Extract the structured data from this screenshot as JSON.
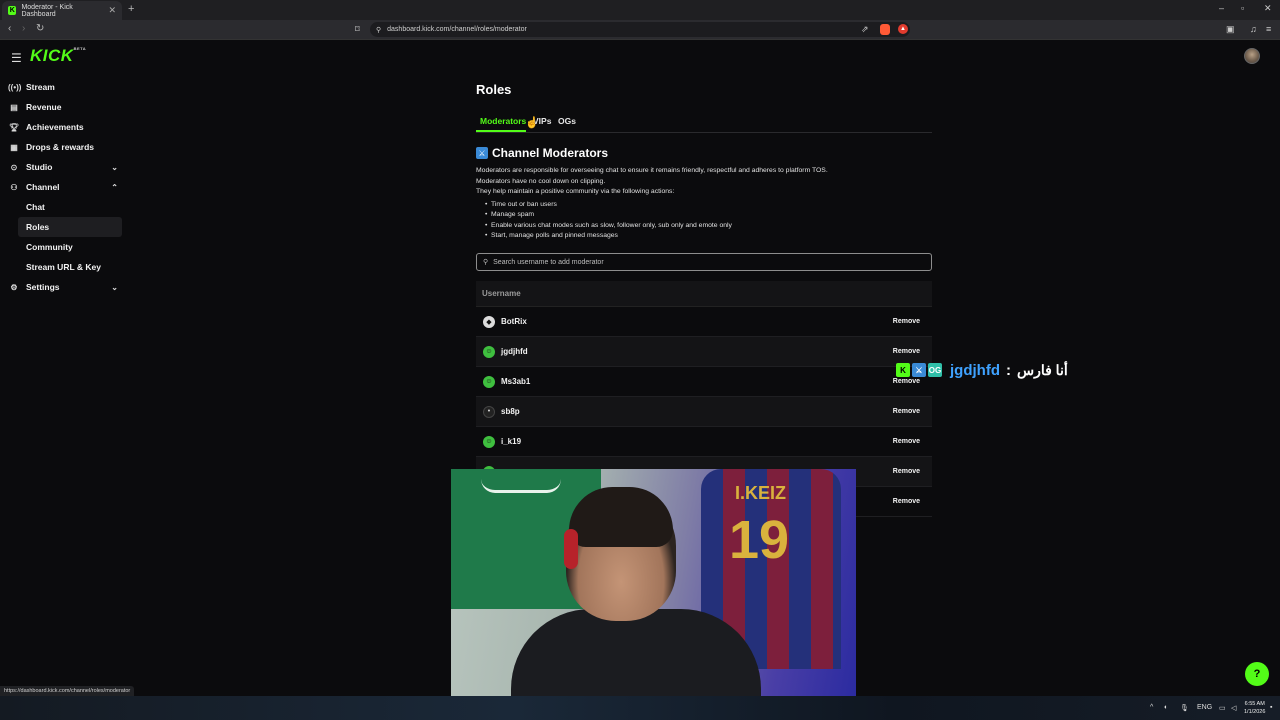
{
  "browser": {
    "tab_title": "Moderator - Kick Dashboard",
    "url": "dashboard.kick.com/channel/roles/moderator",
    "new_tab": "+",
    "status_url": "https://dashboard.kick.com/channel/roles/moderator"
  },
  "header": {
    "logo": "KICK",
    "logo_tag": "BETA"
  },
  "sidebar": {
    "items": [
      {
        "label": "Stream",
        "icon": "broadcast-icon"
      },
      {
        "label": "Revenue",
        "icon": "revenue-icon"
      },
      {
        "label": "Achievements",
        "icon": "trophy-icon"
      },
      {
        "label": "Drops & rewards",
        "icon": "gift-icon"
      },
      {
        "label": "Studio",
        "icon": "studio-icon"
      },
      {
        "label": "Channel",
        "icon": "channel-icon"
      },
      {
        "label": "Settings",
        "icon": "gear-icon"
      }
    ],
    "channel_sub": [
      {
        "label": "Chat"
      },
      {
        "label": "Roles"
      },
      {
        "label": "Community"
      },
      {
        "label": "Stream URL & Key"
      }
    ]
  },
  "main": {
    "title": "Roles",
    "tabs": [
      {
        "label": "Moderators"
      },
      {
        "label": "VIPs"
      },
      {
        "label": "OGs"
      }
    ],
    "section_title": "Channel Moderators",
    "description": [
      "Moderators are responsible for overseeing chat to ensure it remains friendly, respectful and adheres to platform TOS.",
      "Moderators have no cool down on clipping.",
      "They help maintain a positive community via the following actions:"
    ],
    "actions": [
      "Time out or ban users",
      "Manage spam",
      "Enable various chat modes such as slow, follower only, sub only and emote only",
      "Start, manage polls and pinned messages"
    ],
    "search_placeholder": "Search username to add moderator",
    "table_header": "Username",
    "remove_label": "Remove",
    "moderators": [
      {
        "username": "BotRix"
      },
      {
        "username": "jgdjhfd"
      },
      {
        "username": "Ms3ab1"
      },
      {
        "username": "sb8p"
      },
      {
        "username": "i_k19"
      },
      {
        "username": ""
      },
      {
        "username": ""
      }
    ]
  },
  "chat_overlay": {
    "username": "jgdjhfd",
    "separator": ":",
    "message": "أنا فارس"
  },
  "webcam": {
    "jersey_name": "I.KEIZ",
    "jersey_number": "19"
  },
  "taskbar": {
    "lang": "ENG",
    "time": "6:55 AM",
    "date": "1/1/2026"
  },
  "colors": {
    "accent": "#53fc18",
    "background": "#0b0b0d",
    "row_alt": "#141416",
    "chat_username": "#3fa2ff"
  }
}
